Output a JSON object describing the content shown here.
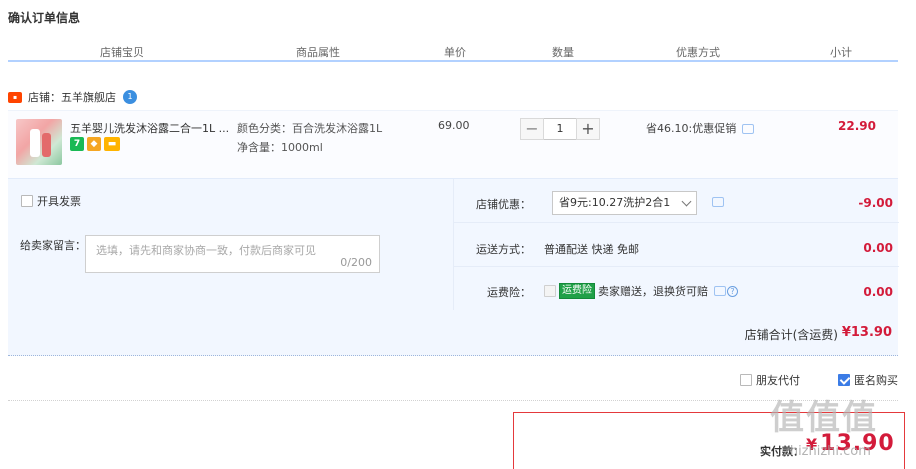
{
  "title": "确认订单信息",
  "columns": [
    "店铺宝贝",
    "商品属性",
    "单价",
    "数量",
    "优惠方式",
    "小计"
  ],
  "shop": {
    "label": "店铺：五羊旗舰店"
  },
  "item": {
    "name": "五羊婴儿洗发沐浴露二合一1L ...",
    "attr_color": "颜色分类：百合洗发沐浴露1L",
    "attr_volume": "净含量：1000ml",
    "price": "69.00",
    "quantity": "1",
    "promo": "省46.10:优惠促销",
    "subtotal": "22.90"
  },
  "invoice_label": "开具发票",
  "memo": {
    "label": "给卖家留言：",
    "placeholder": "选填，请先和商家协商一致，付款后商家可见",
    "count": "0/200"
  },
  "shop_discount": {
    "label": "店铺优惠：",
    "selected": "省9元:10.27洗护2合1",
    "amount": "-9.00"
  },
  "shipping": {
    "label": "运送方式：",
    "value": "普通配送 快递 免邮",
    "amount": "0.00"
  },
  "insurance": {
    "label": "运费险：",
    "tag": "运费险",
    "value": "卖家赠送，退换货可赔",
    "amount": "0.00"
  },
  "shop_total": {
    "label": "店铺合计(含运费)",
    "amount": "¥13.90"
  },
  "friend_pay": "朋友代付",
  "anonymous": "匿名购买",
  "pay": {
    "label": "实付款：",
    "currency": "¥",
    "amount": "13.90"
  },
  "watermark": {
    "logo": "值值值",
    "url": "zhizhizhi.com"
  }
}
